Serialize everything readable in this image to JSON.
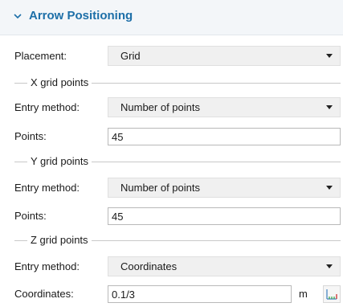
{
  "section": {
    "title": "Arrow Positioning",
    "expanded": true
  },
  "placement": {
    "label": "Placement:",
    "value": "Grid"
  },
  "x_grid": {
    "group_title": "X grid points",
    "entry_label": "Entry method:",
    "entry_value": "Number of points",
    "points_label": "Points:",
    "points_value": "45"
  },
  "y_grid": {
    "group_title": "Y grid points",
    "entry_label": "Entry method:",
    "entry_value": "Number of points",
    "points_label": "Points:",
    "points_value": "45"
  },
  "z_grid": {
    "group_title": "Z grid points",
    "entry_label": "Entry method:",
    "entry_value": "Coordinates",
    "coords_label": "Coordinates:",
    "coords_value": "0.1/3",
    "unit": "m"
  },
  "colors": {
    "accent": "#1d6fa8",
    "header_bg": "#f3f6f9",
    "select_bg": "#f0f0f0"
  },
  "icons": {
    "expand": "chevron-down-icon",
    "dropdown": "dropdown-arrow-icon",
    "range": "range-icon"
  }
}
